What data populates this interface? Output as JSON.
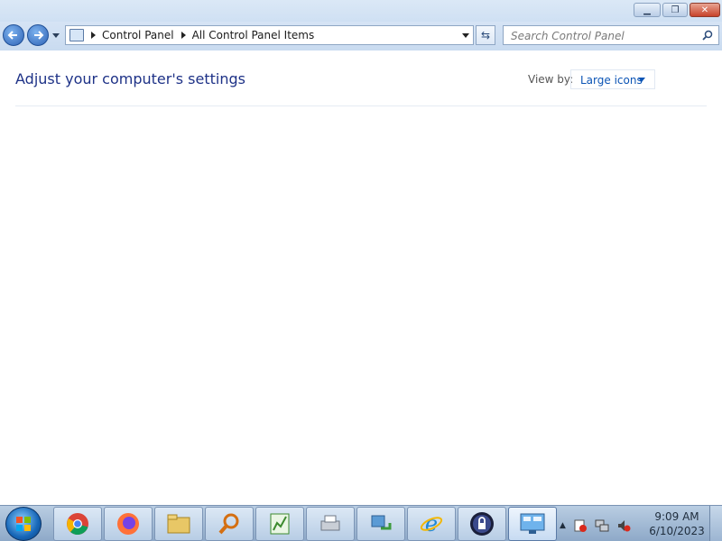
{
  "window": {
    "controls": {
      "minimize_icon": "minimize-icon",
      "maximize_icon": "restore-icon",
      "close_icon": "close-icon"
    }
  },
  "nav": {
    "breadcrumbs": [
      "Control Panel",
      "All Control Panel Items"
    ],
    "search_placeholder": "Search Control Panel"
  },
  "main": {
    "heading": "Adjust your computer's settings",
    "view_by_label": "View by:",
    "view_by_value": "Large icons"
  },
  "taskbar": {
    "apps": [
      "chrome-icon",
      "firefox-icon",
      "file-explorer-icon",
      "search-tool-icon",
      "chart-app-icon",
      "printer-icon",
      "transfer-icon",
      "internet-explorer-icon",
      "lock-app-icon",
      "control-panel-icon"
    ],
    "clock_time": "9:09 AM",
    "clock_date": "6/10/2023"
  },
  "colors": {
    "heading": "#1e3287",
    "link": "#0b54b5",
    "chrome_top": "#dbe8f6",
    "taskbar": "#b9cde2"
  }
}
